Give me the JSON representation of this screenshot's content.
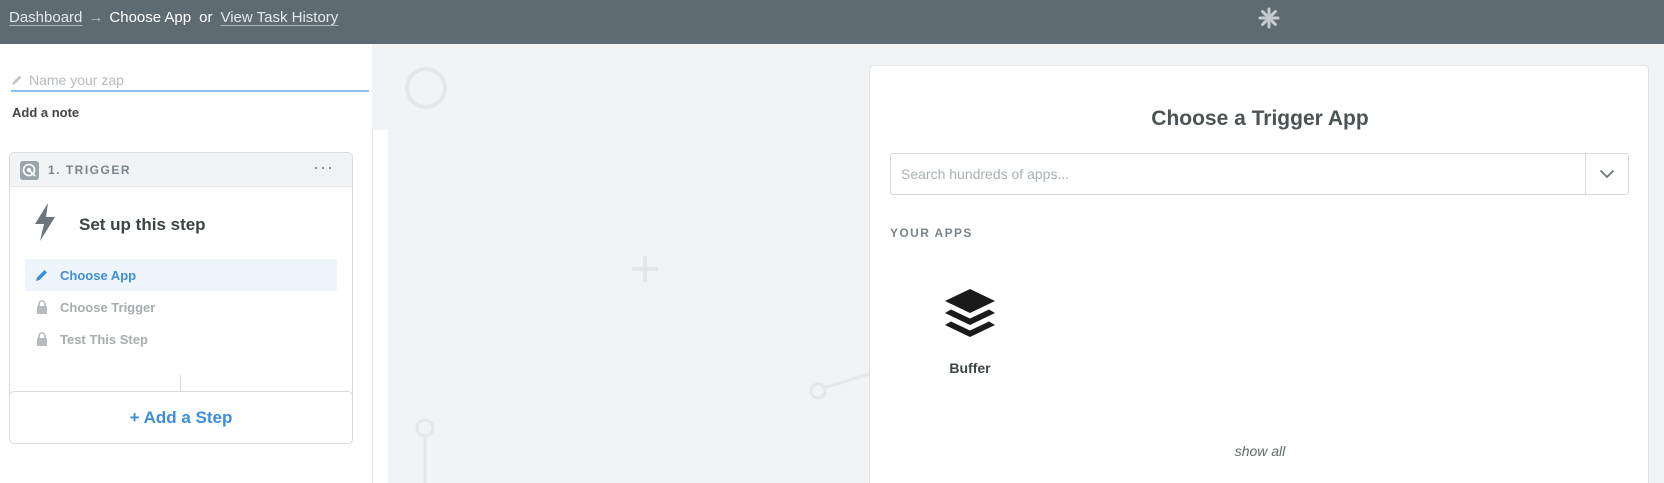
{
  "breadcrumb": {
    "dashboard": "Dashboard",
    "arrow": "→",
    "current": "Choose App",
    "or": "or",
    "history": "View Task History"
  },
  "sidebar": {
    "zap_name_placeholder": "Name your zap",
    "add_note": "Add a note",
    "trigger": {
      "title": "1. TRIGGER",
      "menu": "···",
      "setup": "Set up this step",
      "steps": [
        {
          "label": "Choose App",
          "state": "active"
        },
        {
          "label": "Choose Trigger",
          "state": "locked"
        },
        {
          "label": "Test This Step",
          "state": "locked"
        }
      ]
    },
    "add_step": "+ Add a Step"
  },
  "chooser": {
    "title": "Choose a Trigger App",
    "search_placeholder": "Search hundreds of apps...",
    "your_apps_heading": "YOUR APPS",
    "apps": [
      {
        "name": "Buffer",
        "icon": "buffer-logo-icon"
      }
    ],
    "show_all": "show all"
  },
  "colors": {
    "topbar": "#5f6b72",
    "accent": "#3f8ed8",
    "active_step_bg": "#eef5fc"
  }
}
